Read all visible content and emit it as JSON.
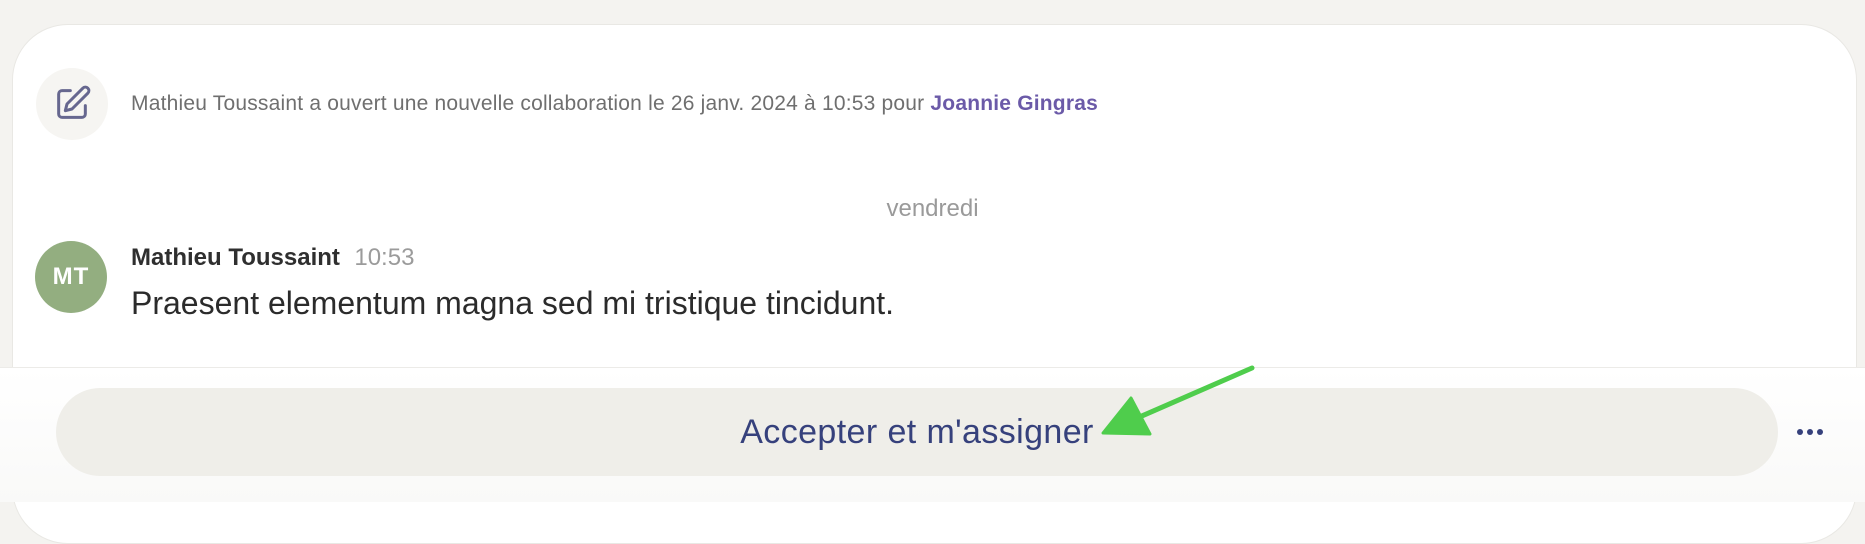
{
  "event": {
    "text": "Mathieu Toussaint a ouvert une nouvelle collaboration le 26 janv. 2024 à 10:53 pour ",
    "link_name": "Joannie Gingras",
    "icon": "edit-icon"
  },
  "day_separator": "vendredi",
  "message": {
    "avatar_initials": "MT",
    "avatar_color": "#93ae80",
    "author": "Mathieu Toussaint",
    "time": "10:53",
    "body": "Praesent elementum magna sed mi tristique tincidunt."
  },
  "footer": {
    "accept_label": "Accepter et m'assigner",
    "more_icon": "more-horizontal-icon"
  },
  "colors": {
    "link": "#6b5aa8",
    "button_text": "#36417c",
    "annotation_arrow": "#4fcd4c"
  }
}
